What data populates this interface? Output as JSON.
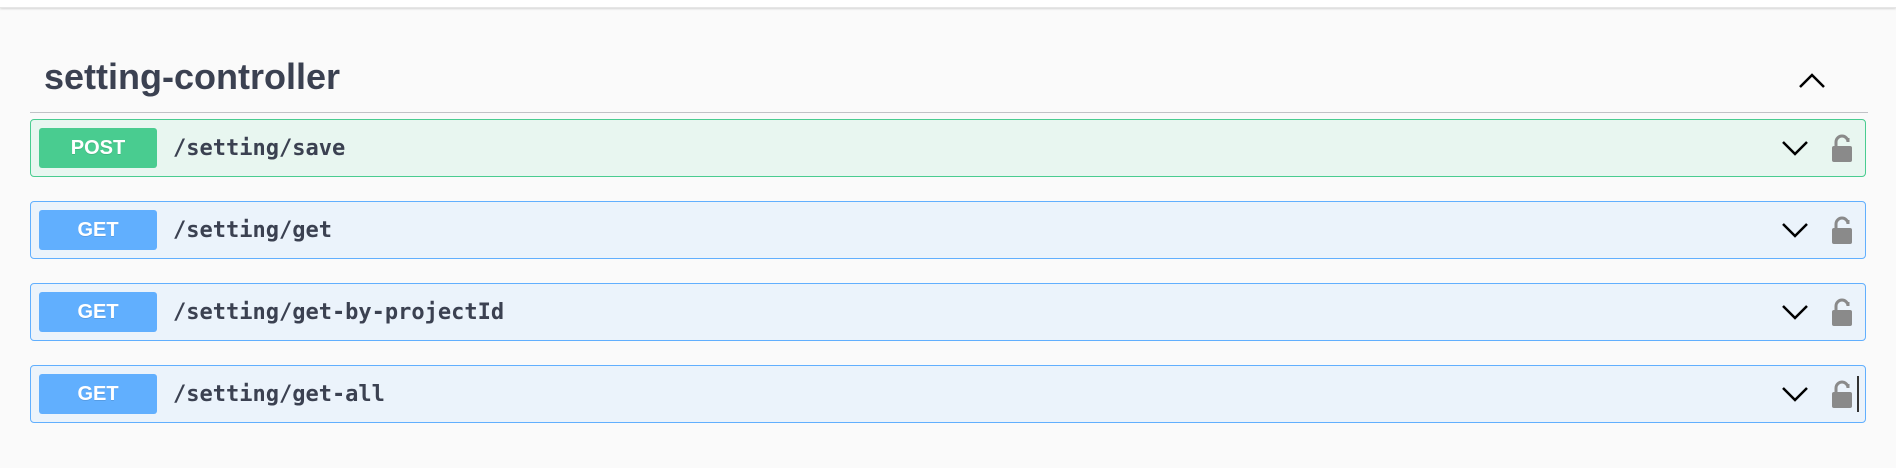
{
  "section": {
    "title": "setting-controller",
    "collapse_icon": "chevron-up-icon"
  },
  "operations": [
    {
      "method": "POST",
      "path": "/setting/save",
      "expand_icon": "chevron-down-icon",
      "lock_icon": "unlocked-padlock-icon"
    },
    {
      "method": "GET",
      "path": "/setting/get",
      "expand_icon": "chevron-down-icon",
      "lock_icon": "unlocked-padlock-icon"
    },
    {
      "method": "GET",
      "path": "/setting/get-by-projectId",
      "expand_icon": "chevron-down-icon",
      "lock_icon": "unlocked-padlock-icon"
    },
    {
      "method": "GET",
      "path": "/setting/get-all",
      "expand_icon": "chevron-down-icon",
      "lock_icon": "unlocked-padlock-icon"
    }
  ],
  "colors": {
    "post": "#49cc90",
    "get": "#61affe",
    "text": "#3b4151"
  }
}
